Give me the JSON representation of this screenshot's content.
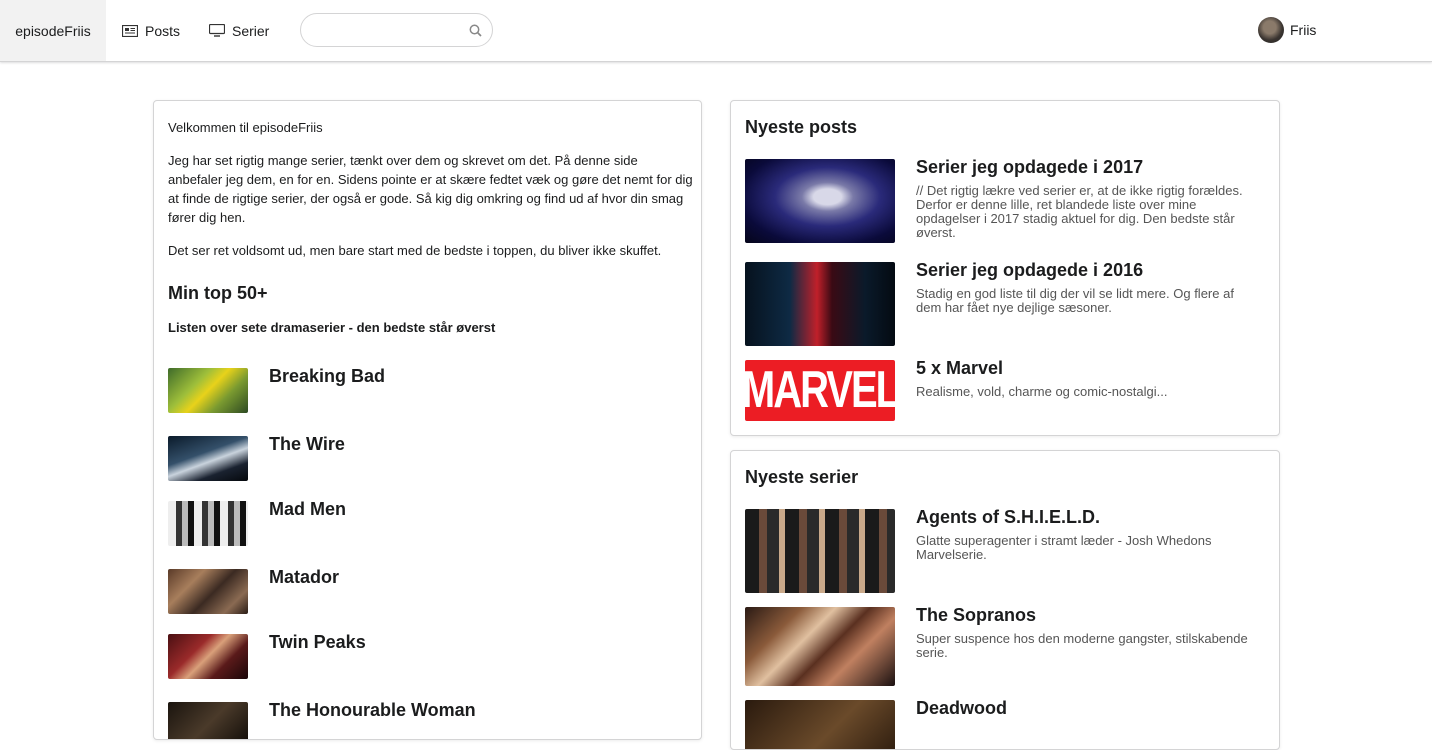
{
  "nav": {
    "brand": "episodeFriis",
    "posts": "Posts",
    "serier": "Serier",
    "search_placeholder": "",
    "user": "Friis"
  },
  "intro": {
    "welcome": "Velkommen til episodeFriis",
    "p1": "Jeg har set rigtig mange serier, tænkt over dem og skrevet om det. På denne side anbefaler jeg dem, en for en. Sidens pointe er at skære fedtet væk og gøre det nemt for dig at finde de rigtige serier, der også er gode. Så kig dig omkring og find ud af hvor din smag fører dig hen.",
    "p2": "Det ser ret voldsomt ud, men bare start med de bedste i toppen, du bliver ikke skuffet."
  },
  "top": {
    "title": "Min top 50+",
    "subtitle": "Listen over sete dramaserier - den bedste står øverst",
    "items": [
      {
        "name": "Breaking Bad"
      },
      {
        "name": "The Wire"
      },
      {
        "name": "Mad Men"
      },
      {
        "name": "Matador"
      },
      {
        "name": "Twin Peaks"
      },
      {
        "name": "The Honourable Woman"
      }
    ]
  },
  "posts": {
    "title": "Nyeste posts",
    "items": [
      {
        "title": "Serier jeg opdagede i 2017",
        "desc": "// Det rigtig lækre ved serier er, at de ikke rigtig forældes. Derfor er denne lille, ret blandede liste over mine opdagelser i 2017 stadig aktuel for dig. Den bedste står øverst."
      },
      {
        "title": "Serier jeg opdagede i 2016",
        "desc": "Stadig en god liste til dig der vil se lidt mere. Og flere af dem har fået nye dejlige sæsoner."
      },
      {
        "title": "5 x Marvel",
        "desc": "Realisme, vold, charme og comic-nostalgi...",
        "logo_text": "MARVEL"
      }
    ]
  },
  "series": {
    "title": "Nyeste serier",
    "items": [
      {
        "title": "Agents of S.H.I.E.L.D.",
        "desc": "Glatte superagenter i stramt læder - Josh Whedons Marvelserie."
      },
      {
        "title": "The Sopranos",
        "desc": "Super suspence hos den moderne gangster, stilskabende serie."
      },
      {
        "title": "Deadwood",
        "desc": ""
      }
    ]
  },
  "colors": {
    "marvel_red": "#ec1d24",
    "brand_bg": "#f2f2f2"
  }
}
